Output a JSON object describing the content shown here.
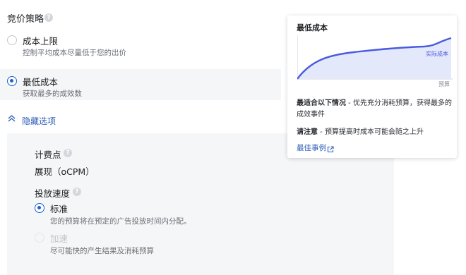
{
  "strategy": {
    "title": "竞价策略"
  },
  "options": [
    {
      "title": "成本上限",
      "desc": "控制平均成本尽量低于您的出价"
    },
    {
      "title": "最低成本",
      "desc": "获取最多的成效数"
    }
  ],
  "toggle": {
    "label": "隐藏选项"
  },
  "hidden": {
    "billing_label": "计费点",
    "billing_value": "展现（oCPM）",
    "delivery_label": "投放速度",
    "standard": {
      "title": "标准",
      "desc": "您的预算将在预定的广告投放时间内分配。"
    },
    "accelerated": {
      "title": "加速",
      "desc": "尽可能快的产生结果及消耗预算"
    }
  },
  "card": {
    "title": "最低成本",
    "curve_label": "实际成本",
    "axis_label": "预算",
    "line1_bold": "最适合以下情况",
    "line1_rest": " - 优先充分消耗预算，获得最多的",
    "line1_cont": "成效事件",
    "line2_bold": "请注意",
    "line2_rest": " - 预算提高时成本可能会随之上升",
    "link": "最佳事例"
  },
  "colors": {
    "accent": "#1f5fd1",
    "curve": "#4a5be0",
    "fill": "#e4e8fb"
  }
}
